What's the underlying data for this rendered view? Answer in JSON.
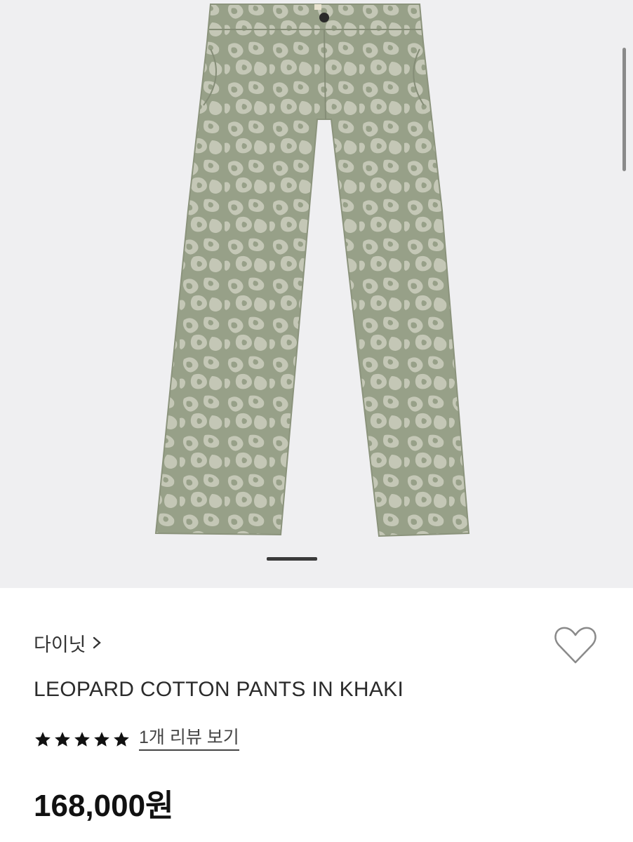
{
  "colors": {
    "hero_bg": "#efeff1",
    "pants_khaki": "#97a088",
    "pattern_light": "#c4c7b6",
    "text_dark": "#111111",
    "text_muted": "#333333",
    "star": "#111111"
  },
  "product": {
    "brand": "다이닛",
    "title": "LEOPARD COTTON PANTS IN KHAKI",
    "rating": 5,
    "review_link": "1개 리뷰 보기",
    "price": "168,000원"
  },
  "icons": {
    "brand_chevron": "chevron-right-icon",
    "wishlist": "heart-outline-icon",
    "star": "star-filled-icon"
  },
  "carousel": {
    "active_index": 1
  }
}
